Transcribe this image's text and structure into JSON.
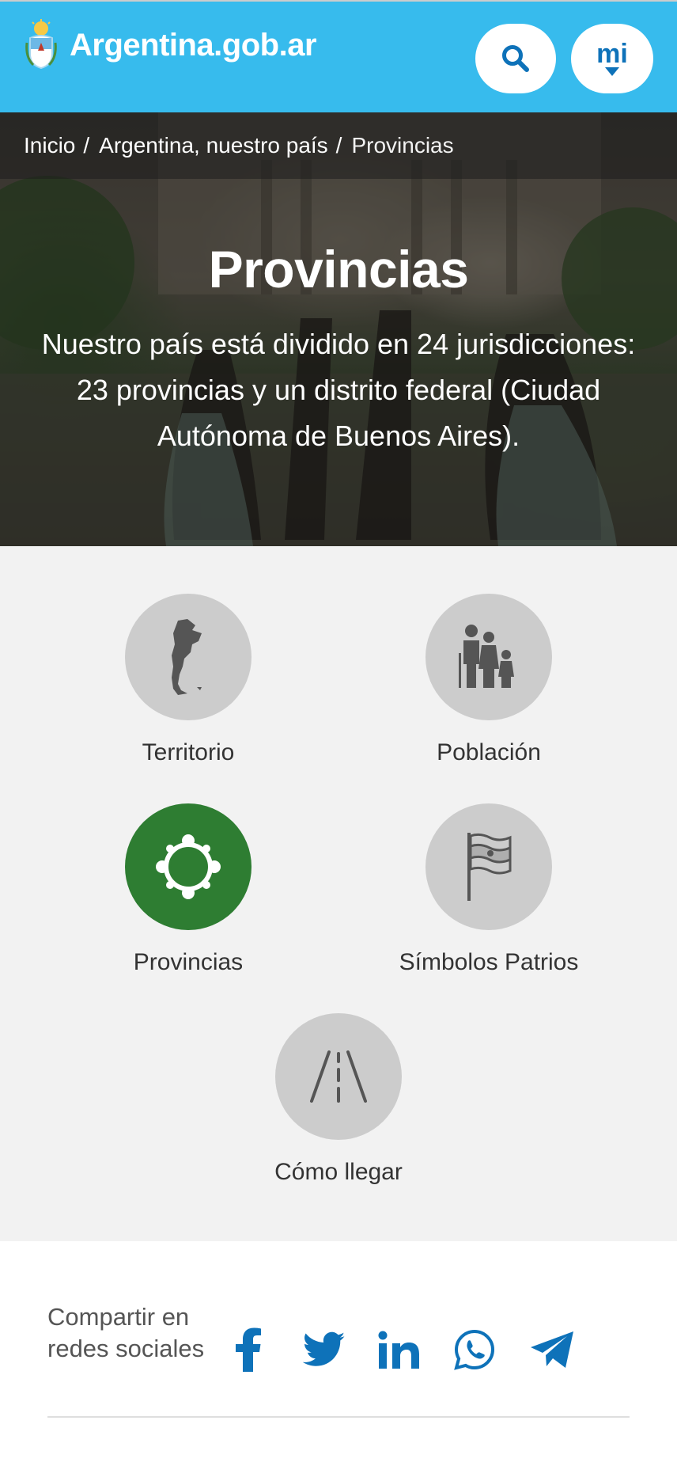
{
  "header": {
    "site_name": "Argentina.gob.ar",
    "mi_label": "mi",
    "search_icon": "search-icon",
    "logo_icon": "coat-of-arms-icon"
  },
  "breadcrumb": {
    "items": [
      "Inicio",
      "Argentina, nuestro país",
      "Provincias"
    ],
    "separator": "/"
  },
  "hero": {
    "title": "Provincias",
    "subtitle": "Nuestro país está dividido en 24 jurisdicciones: 23 provincias y un distrito federal (Ciudad Autónoma de Buenos Aires)."
  },
  "sections": [
    {
      "label": "Territorio",
      "icon": "argentina-map-icon",
      "active": false
    },
    {
      "label": "Población",
      "icon": "family-icon",
      "active": false
    },
    {
      "label": "Provincias",
      "icon": "people-circle-icon",
      "active": true
    },
    {
      "label": "Símbolos Patrios",
      "icon": "flag-icon",
      "active": false
    },
    {
      "label": "Cómo llegar",
      "icon": "road-icon",
      "active": false
    }
  ],
  "share": {
    "label": "Compartir en redes sociales",
    "networks": [
      "facebook",
      "twitter",
      "linkedin",
      "whatsapp",
      "telegram"
    ]
  },
  "colors": {
    "header_bg": "#37bbed",
    "link_blue": "#0e72b9",
    "active_green": "#2e7d32",
    "circle_gray": "#cccccc",
    "section_bg": "#f2f2f2"
  }
}
